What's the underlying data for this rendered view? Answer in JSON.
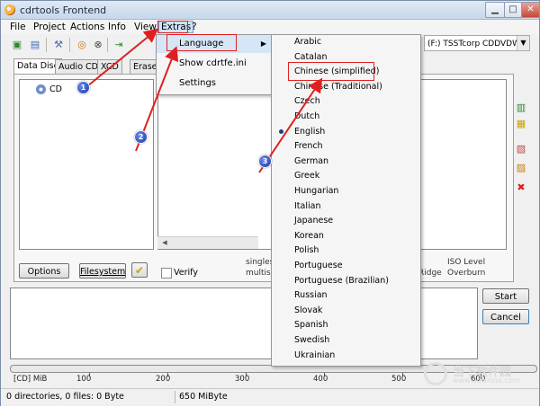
{
  "window": {
    "title": "cdrtools Frontend"
  },
  "menubar": {
    "items": [
      "File",
      "Project",
      "Actions",
      "Info",
      "View",
      "Extras",
      "?"
    ]
  },
  "drive_select": {
    "value": "(F:) TSSTcorp CDDVDW SI"
  },
  "tabs": [
    "Data Disc",
    "Audio CD",
    "XCD",
    "Erase"
  ],
  "tree": {
    "root_label": "CD"
  },
  "buttons": {
    "options": "Options",
    "filesystem": "Filesystem",
    "start": "Start",
    "cancel": "Cancel"
  },
  "verify_label": "Verify",
  "options_text": {
    "single": "singles",
    "multi": "multise",
    "ridge": "Ridge",
    "iso_level": "ISO Level",
    "overburn": "Overburn"
  },
  "ruler": {
    "unit": "[CD] MiB",
    "ticks": [
      "100",
      "200",
      "300",
      "400",
      "500",
      "600"
    ]
  },
  "status": {
    "counts": "0 directories, 0 files: 0 Byte",
    "size": "650 MiByte"
  },
  "extras_menu": {
    "items": [
      "Language",
      "Show cdrtfe.ini",
      "Settings"
    ]
  },
  "language_menu": {
    "items": [
      "Arabic",
      "Catalan",
      "Chinese (simplified)",
      "Chinese (Traditional)",
      "Czech",
      "Dutch",
      "English",
      "French",
      "German",
      "Greek",
      "Hungarian",
      "Italian",
      "Japanese",
      "Korean",
      "Polish",
      "Portuguese",
      "Portuguese (Brazilian)",
      "Russian",
      "Slovak",
      "Spanish",
      "Swedish",
      "Ukrainian"
    ],
    "selected": "English",
    "highlighted": "Chinese (simplified)"
  },
  "annotations": {
    "markers": [
      "1",
      "2",
      "3"
    ],
    "color": "#e02020"
  },
  "watermark": {
    "text": "当下软件园",
    "url": "www.downxia.com"
  },
  "colors": {
    "highlight": "#d6e6f7",
    "title_gradient": "#c7d7ea",
    "marker_blue": "#1836a8"
  }
}
